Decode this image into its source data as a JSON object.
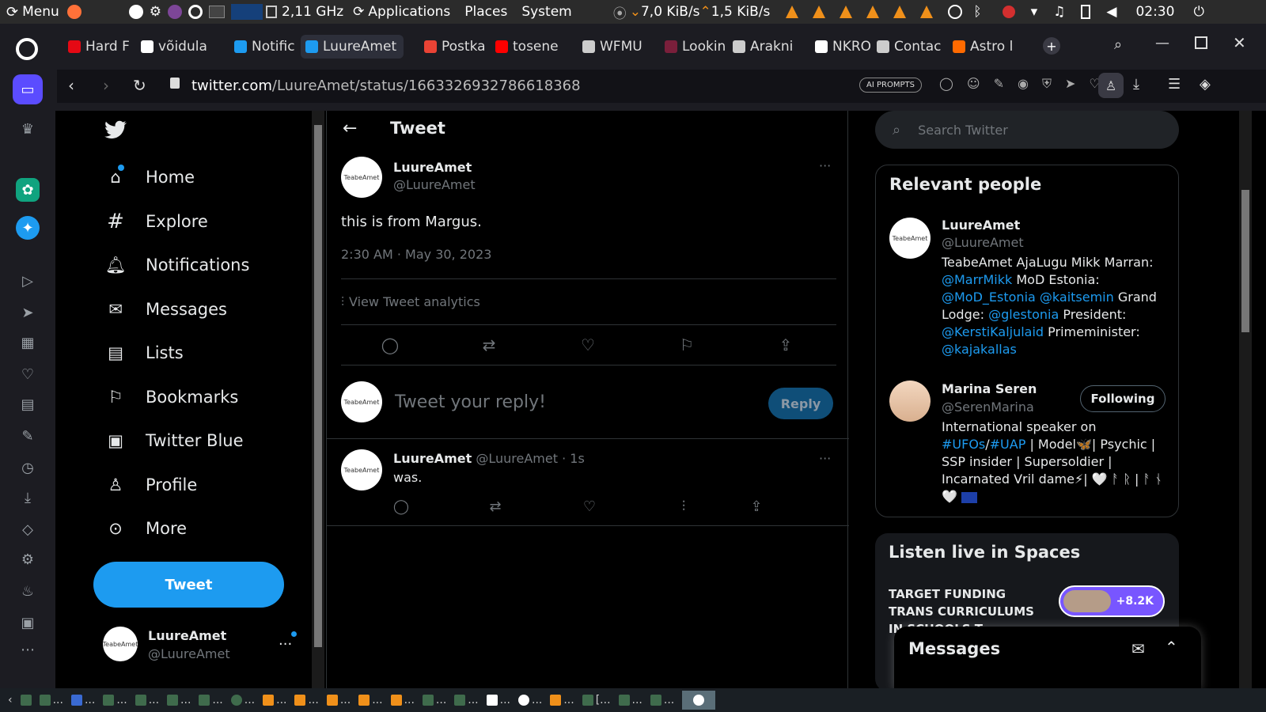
{
  "topbar": {
    "menu_label": "Menu",
    "cpu_freq": "2,11 GHz",
    "applications": "Applications",
    "places": "Places",
    "system": "System",
    "net_down": "7,0 KiB/s",
    "net_up": "1,5 KiB/s",
    "clock": "02:30"
  },
  "tabs": [
    {
      "label": "Hard F",
      "color": "#e50914"
    },
    {
      "label": "võidula",
      "color": "#ffffff"
    },
    {
      "label": "Notific",
      "color": "#1d9bf0"
    },
    {
      "label": "LuureAmet",
      "color": "#1d9bf0"
    },
    {
      "label": "Postka",
      "color": "#ea4335"
    },
    {
      "label": "tosene",
      "color": "#ff0000"
    },
    {
      "label": "WFMU",
      "color": "#cccccc"
    },
    {
      "label": "Lookin",
      "color": "#7a1f3b"
    },
    {
      "label": "Arakni",
      "color": "#cccccc"
    },
    {
      "label": "NKRO",
      "color": "#ffffff"
    },
    {
      "label": "Contac",
      "color": "#cccccc"
    },
    {
      "label": "Astro l",
      "color": "#ff6a00"
    }
  ],
  "url": {
    "host": "twitter.com",
    "path": "/LuureAmet/status/1663326932786618368"
  },
  "ai_prompts": "AI PROMPTS",
  "nav": {
    "home": "Home",
    "explore": "Explore",
    "notifications": "Notifications",
    "messages": "Messages",
    "lists": "Lists",
    "bookmarks": "Bookmarks",
    "twitter_blue": "Twitter Blue",
    "profile": "Profile",
    "more": "More",
    "tweet_button": "Tweet"
  },
  "account": {
    "name": "LuureAmet",
    "handle": "@LuureAmet",
    "avatar_text": "TeabeAmet"
  },
  "header": {
    "title": "Tweet"
  },
  "tweet": {
    "name": "LuureAmet",
    "handle": "@LuureAmet",
    "text": "this is from Margus.",
    "time": "2:30 AM · May 30, 2023",
    "analytics": "View Tweet analytics"
  },
  "reply_box": {
    "placeholder": "Tweet your reply!",
    "button": "Reply"
  },
  "reply": {
    "name": "LuureAmet",
    "handle": "@LuureAmet",
    "time": "· 1s",
    "text": "was."
  },
  "search": {
    "placeholder": "Search Twitter"
  },
  "relevant": {
    "title": "Relevant people",
    "people": [
      {
        "name": "LuureAmet",
        "handle": "@LuureAmet"
      },
      {
        "name": "Marina Seren",
        "handle": "@SerenMarina",
        "follow": "Following"
      }
    ],
    "bio1": {
      "t1": "TeabeAmet AjaLugu Mikk Marran: ",
      "l1": "@MarrMikk",
      "t2": " MoD Estonia: ",
      "l2": "@MoD_Estonia",
      "l3": "@kaitsemin",
      "t3": " Grand Lodge: ",
      "l4": "@glestonia",
      "t4": " President: ",
      "l5": "@KerstiKaljulaid",
      "t5": " Primeminister: ",
      "l6": "@kajakallas"
    },
    "bio2": {
      "t1": "International speaker on ",
      "l1": "#UFOs",
      "t2": "/",
      "l2": "#UAP",
      "t3": " | Model🦋| Psychic | SSP insider | Supersoldier | Incarnated Vril dame⚡| 🤍 ᚨ ᚱ | ᚨ ᚾ 🤍"
    }
  },
  "spaces": {
    "title": "Listen live in Spaces",
    "item": "TARGET FUNDING TRANS CURRICULUMS IN SCHOOLS T",
    "count": "+8.2K"
  },
  "messages_drawer": {
    "title": "Messages"
  }
}
